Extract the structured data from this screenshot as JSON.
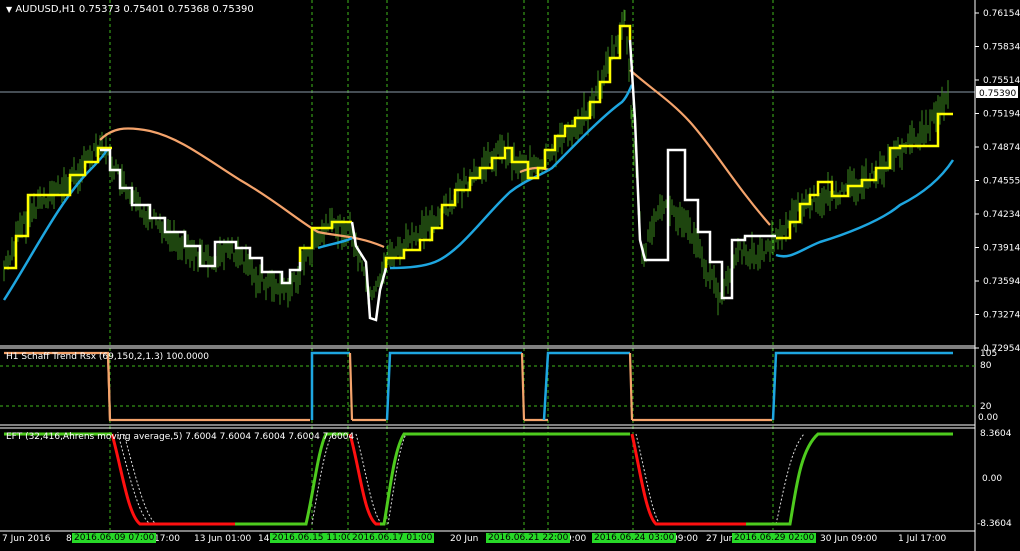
{
  "main": {
    "symbol": "AUDUSD,H1",
    "quote": "0.75373 0.75401 0.75368 0.75390",
    "price_labels": [
      "0.76154",
      "0.75834",
      "0.75514",
      "0.75194",
      "0.74874",
      "0.74555",
      "0.74234",
      "0.73914",
      "0.73594",
      "0.73274",
      "0.72954"
    ],
    "current_price": "0.75390"
  },
  "sub1": {
    "title": "H1 Schaff Trend Rsx (69,150,2,1.3) 100.0000",
    "levels": [
      "105",
      "80",
      "20",
      "0.00"
    ]
  },
  "sub2": {
    "title": "EFT (32,416,Ahrens moving average,5)  7.6004 7.6004 7.6004 7.6004 7.6004",
    "levels": [
      "8.3604",
      "0.00",
      "-8.3604"
    ]
  },
  "time_axis": {
    "labels": [
      "7 Jun 2016",
      "8",
      "17:00",
      "13 Jun 01:00",
      "14",
      "20 Jun",
      "9:00",
      "09:00",
      "27 Jun",
      "30 Jun 09:00",
      "1 Jul 17:00"
    ],
    "highlights": [
      "2016.06.09 07:00",
      "2016.06.15 11:00",
      "2016.06.17 01:00",
      "2016.06.21 22:00",
      "2016.06.24 03:00",
      "2016.06.29 02:00"
    ]
  },
  "colors": {
    "background": "#000000",
    "candles": "#3d8a1e",
    "yellow_line": "#ffff00",
    "white_line": "#ffffff",
    "orange_line": "#f4a36b",
    "blue_line": "#1ea6e0",
    "green_line": "#4ecb1e",
    "red_line": "#ff1010",
    "vgrid": "#3fb71d",
    "highlight_bg": "#27d927"
  },
  "icons": {
    "menu": "dropdown-triangle-icon"
  }
}
